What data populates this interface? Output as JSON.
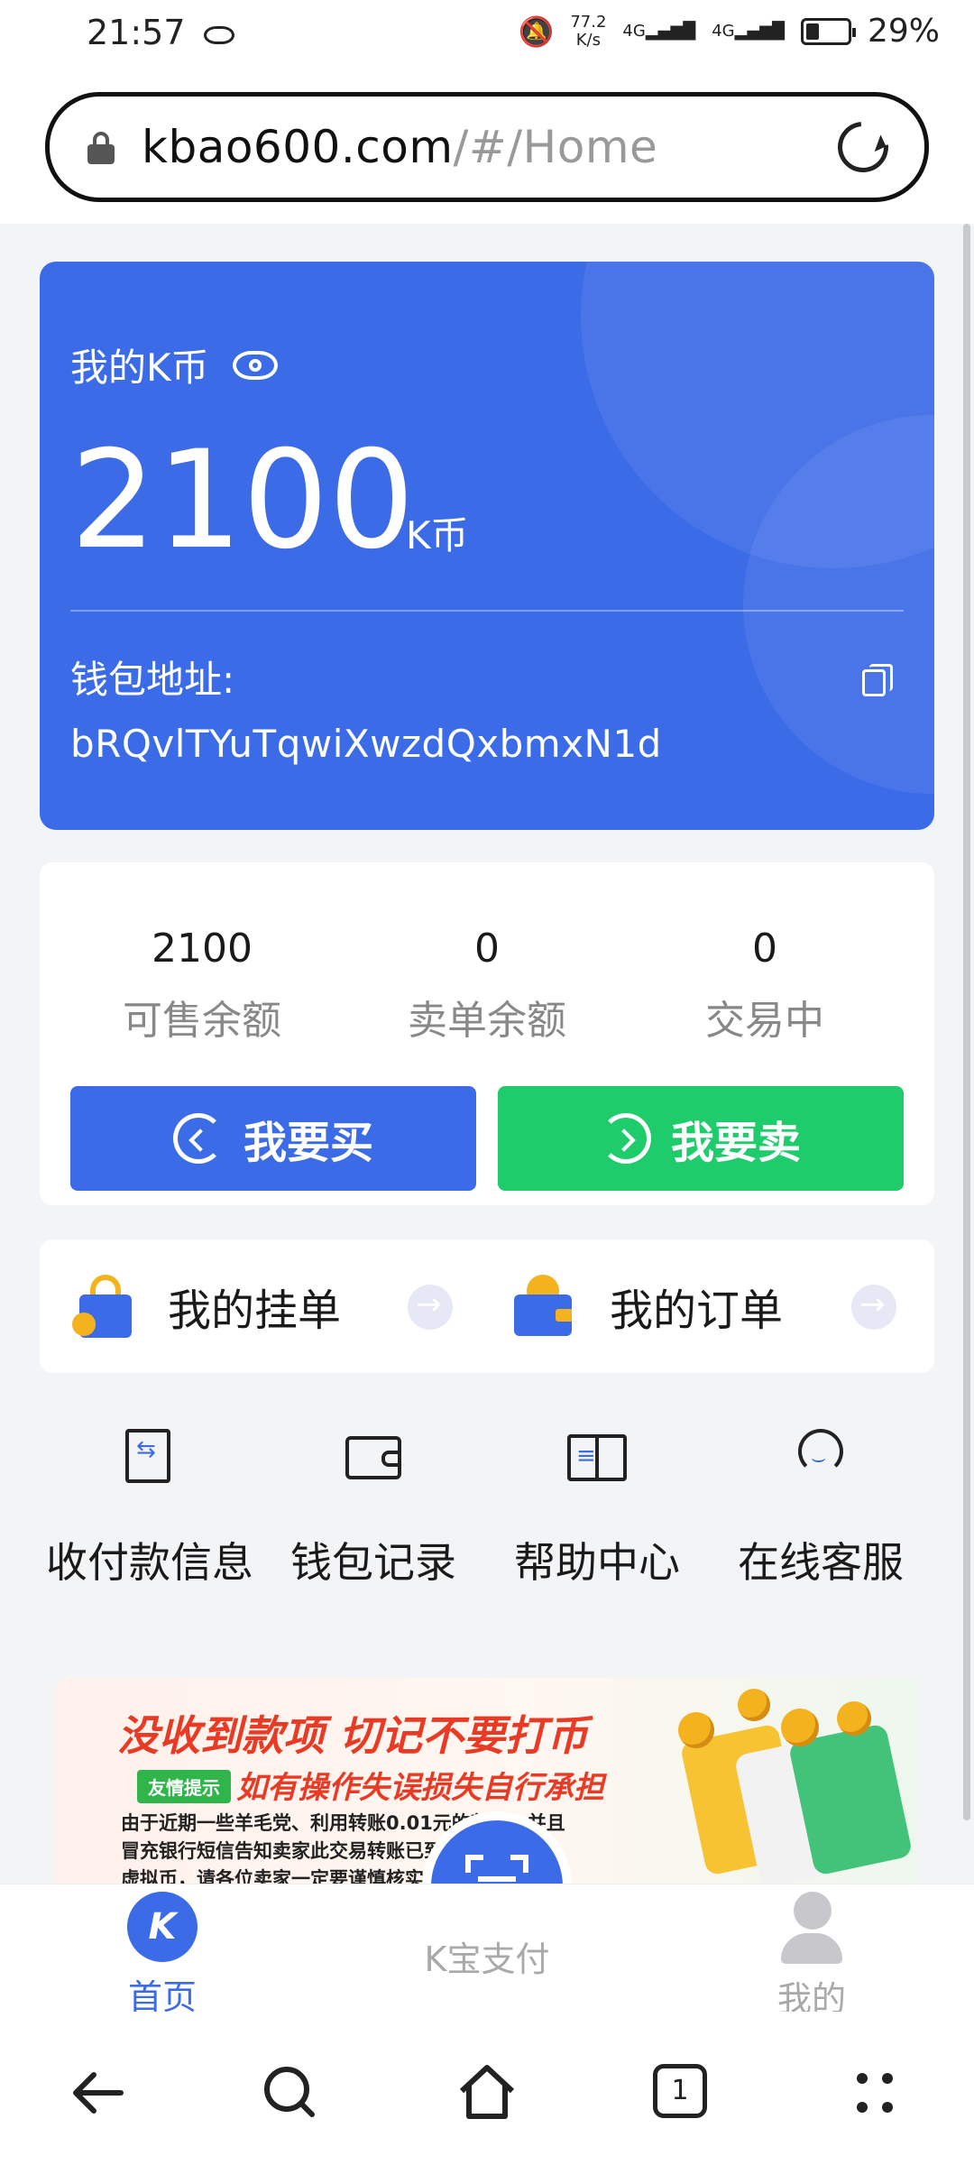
{
  "status_bar": {
    "time": "21:57",
    "net_speed_value": "77.2",
    "net_speed_unit": "K/s",
    "net_type_1": "4G",
    "net_type_2": "4G",
    "battery": "29%"
  },
  "browser": {
    "url_host": "kbao600.com",
    "url_path": "/#/Home"
  },
  "balance_card": {
    "title": "我的K币",
    "amount": "2100",
    "unit": "K币",
    "wallet_label": "钱包地址:",
    "wallet_address": "bRQvlTYuTqwiXwzdQxbmxN1d"
  },
  "stats": [
    {
      "value": "2100",
      "label": "可售余额"
    },
    {
      "value": "0",
      "label": "卖单余额"
    },
    {
      "value": "0",
      "label": "交易中"
    }
  ],
  "actions": {
    "buy_label": "我要买",
    "sell_label": "我要卖"
  },
  "orders": {
    "listings_label": "我的挂单",
    "orders_label": "我的订单"
  },
  "services": [
    {
      "label": "收付款信息",
      "icon": "payment-info-icon"
    },
    {
      "label": "钱包记录",
      "icon": "wallet-icon"
    },
    {
      "label": "帮助中心",
      "icon": "book-icon"
    },
    {
      "label": "在线客服",
      "icon": "headset-icon"
    }
  ],
  "banner": {
    "title": "没收到款项 切记不要打币",
    "tag": "友情提示",
    "subtitle": "如有操作失误损失自行承担",
    "body_line1": "由于近期一些羊毛党、利用转账0.01元的范围，并且",
    "body_line2": "冒充银行短信告知卖家此交易转账已到账来骗取",
    "body_line3": "虚拟币，请各位卖家一定要谨慎核实"
  },
  "app_nav": {
    "home_label": "首页",
    "home_logo": "K",
    "pay_label": "K宝支付",
    "profile_label": "我的"
  },
  "system_nav": {
    "tabs_count": "1"
  },
  "colors": {
    "primary_blue": "#3c6be8",
    "sell_green": "#1fcc6c",
    "page_bg": "#f3f4f6",
    "banner_red": "#e83a25"
  }
}
